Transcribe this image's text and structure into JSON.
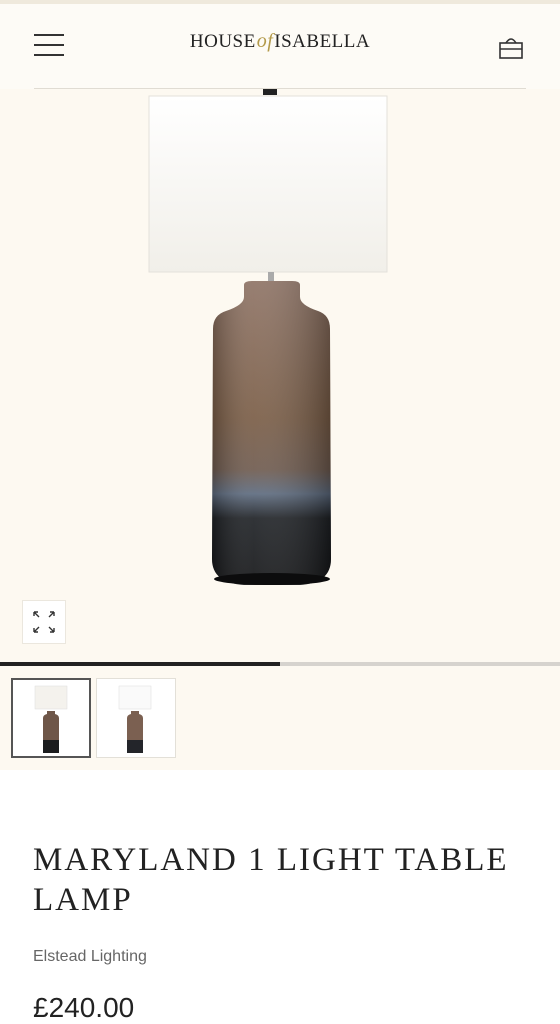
{
  "header": {
    "logo_left": "HOUSE",
    "logo_of": "of",
    "logo_right": "ISABELLA",
    "menu_icon": "hamburger-icon",
    "bag_icon": "shopping-bag-icon"
  },
  "gallery": {
    "expand_icon": "expand-arrows-icon",
    "progress_fraction": 0.5,
    "thumbnails": [
      {
        "name": "lamp-brown-ceramic-thumbnail",
        "active": true
      },
      {
        "name": "lamp-brown-ceramic-alt-thumbnail",
        "active": false
      }
    ]
  },
  "product": {
    "title": "MARYLAND 1 LIGHT TABLE LAMP",
    "brand": "Elstead Lighting",
    "price": "£240.00"
  },
  "colors": {
    "background": "#fdfbf6",
    "accent_gold": "#b39a4a",
    "text": "#222222"
  }
}
